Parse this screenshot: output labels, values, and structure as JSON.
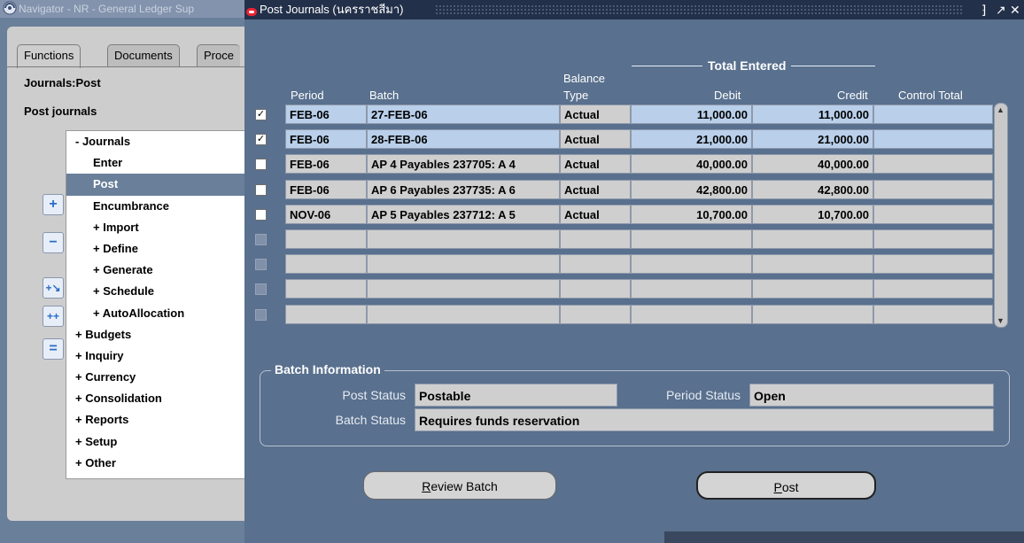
{
  "navigator": {
    "title": "Navigator - NR - General Ledger Sup",
    "tabs": [
      "Functions",
      "Documents",
      "Proce"
    ],
    "section_title": "Journals:Post",
    "selected_function": "Post journals",
    "tree": [
      {
        "label": "- Journals",
        "level": 0,
        "selected": false
      },
      {
        "label": "Enter",
        "level": 1,
        "selected": false
      },
      {
        "label": "Post",
        "level": 1,
        "selected": true
      },
      {
        "label": "Encumbrance",
        "level": 1,
        "selected": false
      },
      {
        "label": "+ Import",
        "level": 1,
        "selected": false
      },
      {
        "label": "+ Define",
        "level": 1,
        "selected": false
      },
      {
        "label": "+ Generate",
        "level": 1,
        "selected": false
      },
      {
        "label": "+ Schedule",
        "level": 1,
        "selected": false
      },
      {
        "label": "+ AutoAllocation",
        "level": 1,
        "selected": false
      },
      {
        "label": "+ Budgets",
        "level": 0,
        "selected": false
      },
      {
        "label": "+ Inquiry",
        "level": 0,
        "selected": false
      },
      {
        "label": "+ Currency",
        "level": 0,
        "selected": false
      },
      {
        "label": "+ Consolidation",
        "level": 0,
        "selected": false
      },
      {
        "label": "+ Reports",
        "level": 0,
        "selected": false
      },
      {
        "label": "+ Setup",
        "level": 0,
        "selected": false
      },
      {
        "label": "+ Other",
        "level": 0,
        "selected": false
      }
    ],
    "side_buttons": [
      "expand-icon",
      "collapse-icon",
      "expand-branch-icon",
      "expand-all-icon",
      "collapse-all-icon"
    ]
  },
  "post_journals": {
    "title": "Post Journals (นครราชสีมา)",
    "window_controls": [
      "⁆",
      "↗",
      "✕"
    ],
    "headers": {
      "period": "Period",
      "batch": "Batch",
      "balance_type_line1": "Balance",
      "balance_type_line2": "Type",
      "total_entered": "Total Entered",
      "debit": "Debit",
      "credit": "Credit",
      "control_total": "Control Total"
    },
    "rows": [
      {
        "checked": true,
        "period": "FEB-06",
        "batch": "27-FEB-06",
        "type": "Actual",
        "debit": "11,000.00",
        "credit": "11,000.00",
        "control": "",
        "highlight": true
      },
      {
        "checked": true,
        "period": "FEB-06",
        "batch": "28-FEB-06",
        "type": "Actual",
        "debit": "21,000.00",
        "credit": "21,000.00",
        "control": "",
        "highlight": true
      },
      {
        "checked": false,
        "period": "FEB-06",
        "batch": "AP 4 Payables 237705: A 4",
        "type": "Actual",
        "debit": "40,000.00",
        "credit": "40,000.00",
        "control": "",
        "highlight": false
      },
      {
        "checked": false,
        "period": "FEB-06",
        "batch": "AP 6 Payables 237735: A 6",
        "type": "Actual",
        "debit": "42,800.00",
        "credit": "42,800.00",
        "control": "",
        "highlight": false
      },
      {
        "checked": false,
        "period": "NOV-06",
        "batch": "AP 5 Payables 237712: A 5",
        "type": "Actual",
        "debit": "10,700.00",
        "credit": "10,700.00",
        "control": "",
        "highlight": false
      },
      {
        "checked": false,
        "period": "",
        "batch": "",
        "type": "",
        "debit": "",
        "credit": "",
        "control": "",
        "highlight": false,
        "empty": true
      },
      {
        "checked": false,
        "period": "",
        "batch": "",
        "type": "",
        "debit": "",
        "credit": "",
        "control": "",
        "highlight": false,
        "empty": true
      },
      {
        "checked": false,
        "period": "",
        "batch": "",
        "type": "",
        "debit": "",
        "credit": "",
        "control": "",
        "highlight": false,
        "empty": true
      },
      {
        "checked": false,
        "period": "",
        "batch": "",
        "type": "",
        "debit": "",
        "credit": "",
        "control": "",
        "highlight": false,
        "empty": true
      }
    ],
    "batch_info": {
      "title": "Batch Information",
      "post_status_label": "Post Status",
      "post_status": "Postable",
      "period_status_label": "Period Status",
      "period_status": "Open",
      "batch_status_label": "Batch Status",
      "batch_status": "Requires funds reservation"
    },
    "buttons": {
      "review_first": "R",
      "review_rest": "eview Batch",
      "post_first": "P",
      "post_rest": "ost"
    }
  },
  "colors": {
    "window_bg": "#59708e",
    "titlebar": "#23304a",
    "highlight_row": "#b9cfea",
    "field": "#cfcfcf"
  }
}
